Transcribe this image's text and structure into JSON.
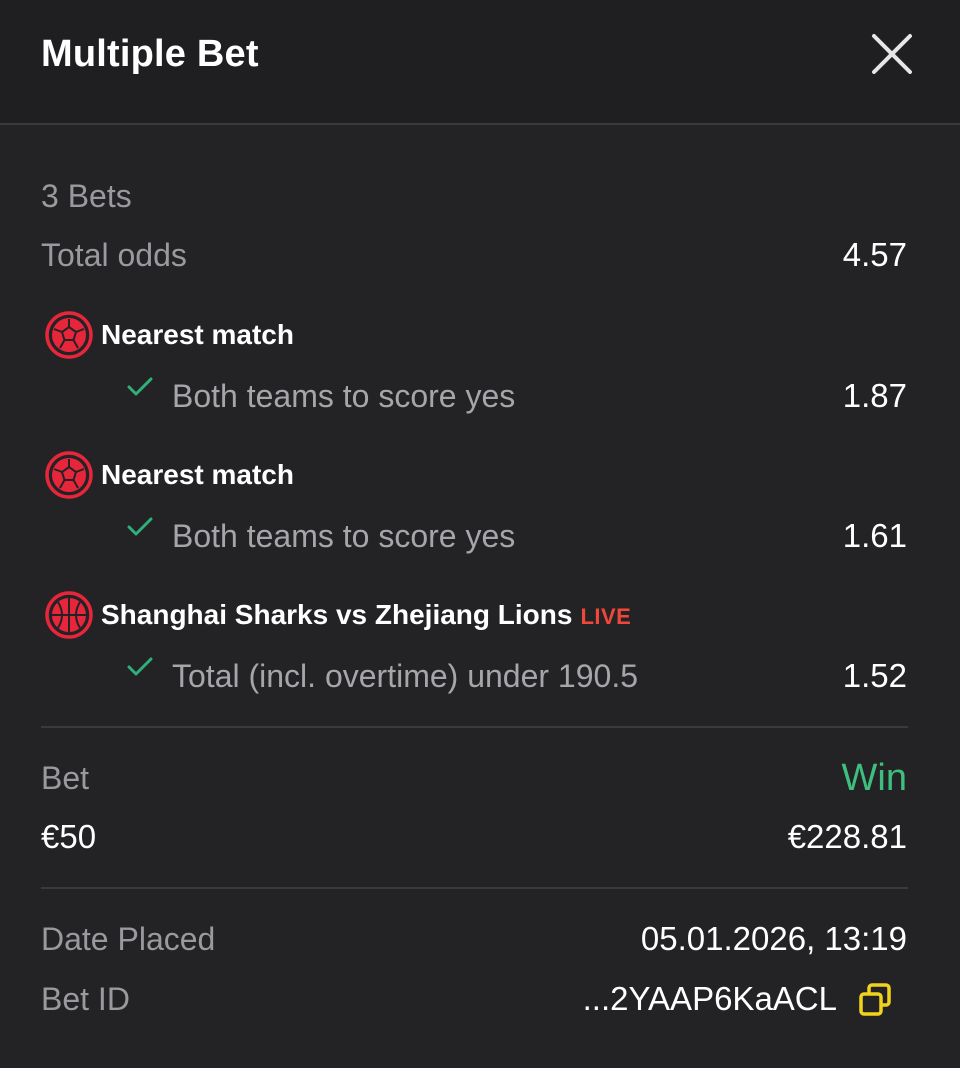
{
  "header": {
    "title": "Multiple Bet"
  },
  "summary": {
    "bets_count": "3 Bets",
    "total_odds_label": "Total odds",
    "total_odds_value": "4.57"
  },
  "selections": [
    {
      "sport_icon": "soccer-ball-icon",
      "event": "Nearest match",
      "live": "",
      "market": "Both teams to score yes",
      "odds": "1.87",
      "status_icon": "check-icon"
    },
    {
      "sport_icon": "soccer-ball-icon",
      "event": "Nearest match",
      "live": "",
      "market": "Both teams to score yes",
      "odds": "1.61",
      "status_icon": "check-icon"
    },
    {
      "sport_icon": "basketball-icon",
      "event": "Shanghai Sharks vs Zhejiang Lions",
      "live": "LIVE",
      "market": "Total (incl. overtime) under 190.5",
      "odds": "1.52",
      "status_icon": "check-icon"
    }
  ],
  "stake": {
    "bet_label": "Bet",
    "bet_value": "€50",
    "win_label": "Win",
    "win_value": "€228.81"
  },
  "details": {
    "date_label": "Date Placed",
    "date_value": "05.01.2026, 13:19",
    "id_label": "Bet ID",
    "id_value": "...2YAAP6KaACL"
  },
  "colors": {
    "background": "#232326",
    "win_green": "#3fbf7f",
    "check_green": "#2fb07a",
    "sport_icon_red": "#e8263b",
    "live_red": "#f0473a",
    "copy_icon_yellow": "#f2d31b"
  }
}
